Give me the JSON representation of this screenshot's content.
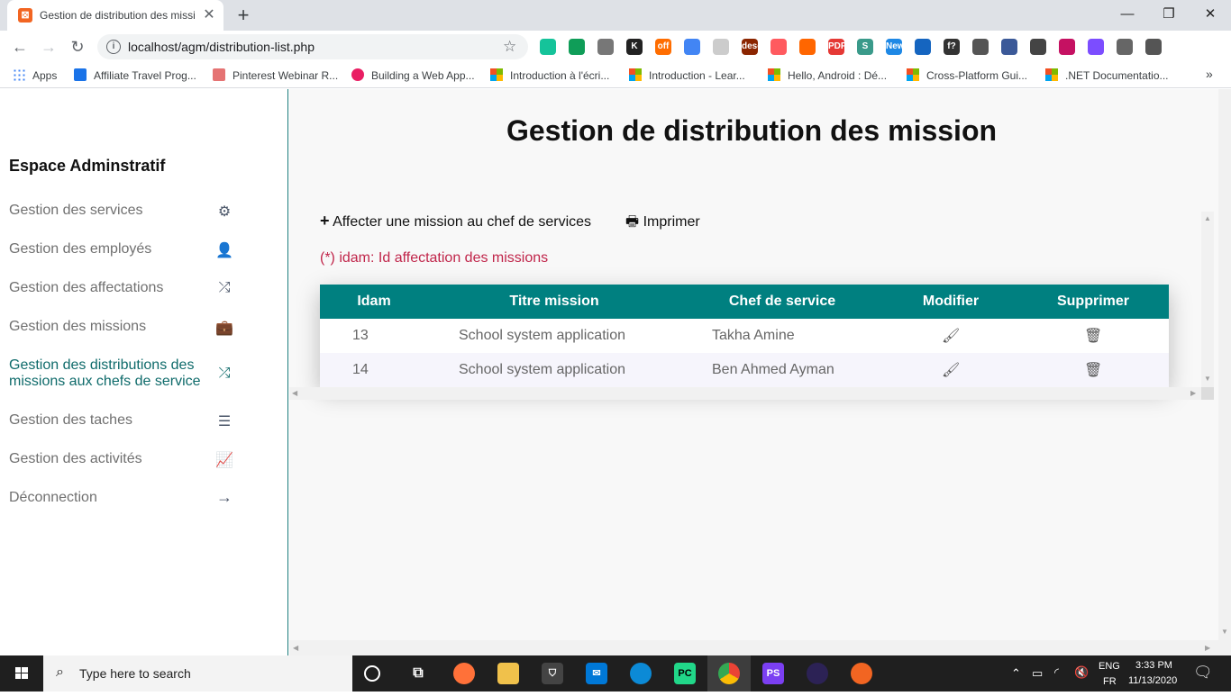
{
  "browser": {
    "tab_title": "Gestion de distribution des missi",
    "url": "localhost/agm/distribution-list.php",
    "bookmarks": [
      {
        "label": "Apps"
      },
      {
        "label": "Affiliate Travel Prog..."
      },
      {
        "label": "Pinterest Webinar R..."
      },
      {
        "label": "Building a Web App..."
      },
      {
        "label": "Introduction à l'écri..."
      },
      {
        "label": "Introduction - Lear..."
      },
      {
        "label": "Hello, Android : Dé..."
      },
      {
        "label": "Cross-Platform Gui..."
      },
      {
        "label": ".NET Documentatio..."
      }
    ],
    "extensions": [
      {
        "label": "",
        "color": "#15c39a"
      },
      {
        "label": "",
        "color": "#0f9d58"
      },
      {
        "label": "",
        "color": "#777777"
      },
      {
        "label": "K",
        "color": "#222222"
      },
      {
        "label": "off",
        "color": "#ff6d00"
      },
      {
        "label": "",
        "color": "#4285f4"
      },
      {
        "label": "",
        "color": "#cccccc"
      },
      {
        "label": "desc",
        "color": "#8b2500"
      },
      {
        "label": "",
        "color": "#ff5a5f"
      },
      {
        "label": "",
        "color": "#ff6600"
      },
      {
        "label": "PDF",
        "color": "#e53935"
      },
      {
        "label": "S",
        "color": "#3a9a8a"
      },
      {
        "label": "New",
        "color": "#1e88e5"
      },
      {
        "label": "",
        "color": "#1565c0"
      },
      {
        "label": "f?",
        "color": "#333333"
      },
      {
        "label": "",
        "color": "#555555"
      },
      {
        "label": "",
        "color": "#3b5998"
      },
      {
        "label": "",
        "color": "#444444"
      },
      {
        "label": "",
        "color": "#c51162"
      },
      {
        "label": "",
        "color": "#7c4dff"
      },
      {
        "label": "",
        "color": "#666666"
      },
      {
        "label": "",
        "color": "#555555"
      }
    ]
  },
  "sidebar": {
    "heading": "Espace Adminstratif",
    "items": [
      {
        "label": "Gestion des services",
        "icon": "cogs-icon",
        "glyph": "⚙"
      },
      {
        "label": "Gestion des employés",
        "icon": "user-tie-icon",
        "glyph": "👤"
      },
      {
        "label": "Gestion des affectations",
        "icon": "random-icon",
        "glyph": "⤮"
      },
      {
        "label": "Gestion des missions",
        "icon": "briefcase-icon",
        "glyph": "💼"
      },
      {
        "label": "Gestion des distributions des missions aux chefs de service",
        "icon": "random-icon",
        "glyph": "⤮",
        "active": true
      },
      {
        "label": "Gestion des taches",
        "icon": "tasks-icon",
        "glyph": "☰"
      },
      {
        "label": "Gestion des activités",
        "icon": "chart-line-icon",
        "glyph": "📈"
      },
      {
        "label": "Déconnection",
        "icon": "arrow-right-icon",
        "glyph": "→"
      }
    ]
  },
  "main": {
    "title": "Gestion de distribution des mission",
    "add_label": "Affecter une mission au chef de services",
    "print_label": "Imprimer",
    "note": "(*) idam: Id affectation des missions",
    "table": {
      "headers": [
        "Idam",
        "Titre mission",
        "Chef de service",
        "Modifier",
        "Supprimer"
      ],
      "rows": [
        {
          "idam": "13",
          "titre": "School system application",
          "chef": "Takha Amine"
        },
        {
          "idam": "14",
          "titre": "School system application",
          "chef": "Ben Ahmed Ayman"
        }
      ]
    },
    "colors": {
      "header": "#008080",
      "note": "#c0254a",
      "active": "#0f6b6b"
    }
  },
  "taskbar": {
    "search_placeholder": "Type here to search",
    "lang_top": "ENG",
    "lang_bottom": "FR",
    "time": "3:33 PM",
    "date": "11/13/2020"
  }
}
